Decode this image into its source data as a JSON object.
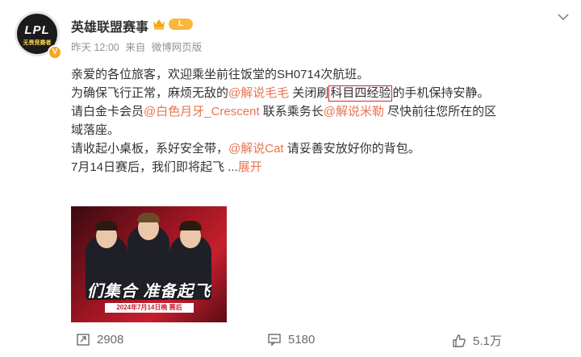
{
  "author": {
    "name": "英雄联盟赛事",
    "avatar_text": "LPL",
    "avatar_subtext": "无畏竞赛者",
    "level_badge": "L"
  },
  "meta": {
    "time": "昨天 12:00",
    "source_prefix": "来自",
    "source": "微博网页版"
  },
  "content": {
    "line1": "亲爱的各位旅客，欢迎乘坐前往饭堂的SH0714次航班。",
    "line2_a": "为确保飞行正常，麻烦无敌的",
    "line2_mention": "@解说毛毛",
    "line2_b": " 关闭刷",
    "line2_highlight": "科目四经验",
    "line2_c": "的手机保持安静。",
    "line3_a": "请白金卡会员",
    "line3_mention1": "@白色月牙_Crescent",
    "line3_b": " 联系乘务长",
    "line3_mention2": "@解说米勒",
    "line3_c": " 尽快前往您所在的区",
    "line4": "域落座。",
    "line5_a": "请收起小桌板，系好安全带，",
    "line5_mention": "@解说Cat",
    "line5_b": " 请妥善安放好你的背包。",
    "line6_a": "7月14日赛后，我们即将起飞 ...",
    "line6_expand": "展开"
  },
  "image": {
    "title": "们集合  准备起飞",
    "date_label": "2024年7月14日晚 赛后"
  },
  "actions": {
    "repost_count": "2908",
    "comment_count": "5180",
    "like_count": "5.1万"
  },
  "icons": {
    "more": "chevron-down-icon",
    "repost": "repost-icon",
    "comment": "comment-icon",
    "like": "thumbs-up-icon",
    "crown": "crown-icon"
  },
  "colors": {
    "mention": "#eb7350",
    "highlight_border": "#d9252c",
    "meta": "#939393"
  }
}
